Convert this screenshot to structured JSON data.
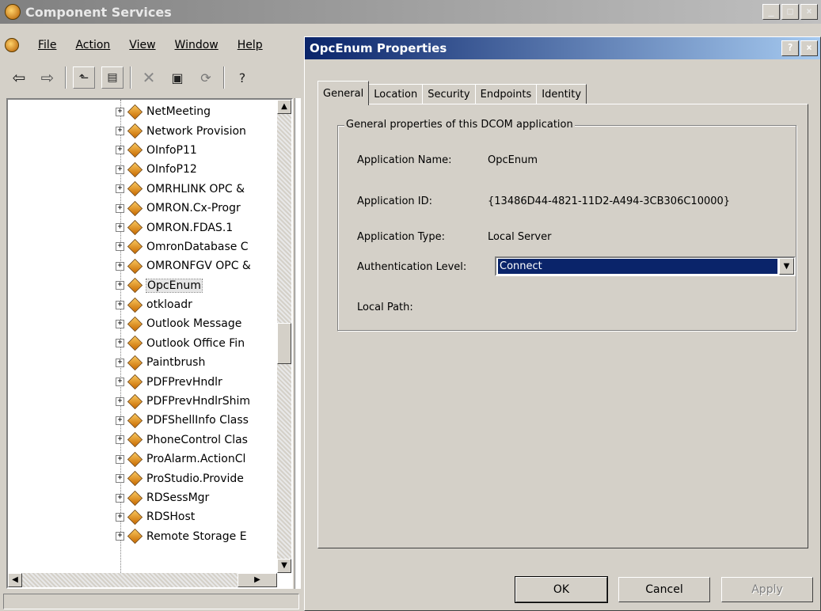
{
  "window": {
    "title": "Component Services",
    "icon": "component-services-icon",
    "caption_buttons": [
      "_",
      "□",
      "×"
    ]
  },
  "menu": {
    "items": [
      {
        "label": "File",
        "accel": "F"
      },
      {
        "label": "Action",
        "accel": "A"
      },
      {
        "label": "View",
        "accel": "V"
      },
      {
        "label": "Window",
        "accel": "W"
      },
      {
        "label": "Help",
        "accel": "H"
      }
    ]
  },
  "toolbar": {
    "icons": [
      "back-arrow-icon",
      "forward-arrow-icon",
      "up-folder-icon",
      "show-hide-tree-icon",
      "delete-icon",
      "properties-icon",
      "refresh-icon",
      "help-icon"
    ]
  },
  "tree": {
    "items": [
      {
        "label": "NetMeeting",
        "selected": false
      },
      {
        "label": "Network Provision",
        "selected": false
      },
      {
        "label": "OInfoP11",
        "selected": false
      },
      {
        "label": "OInfoP12",
        "selected": false
      },
      {
        "label": "OMRHLINK OPC &",
        "selected": false
      },
      {
        "label": "OMRON.Cx-Progr",
        "selected": false
      },
      {
        "label": "OMRON.FDAS.1",
        "selected": false
      },
      {
        "label": "OmronDatabase C",
        "selected": false
      },
      {
        "label": "OMRONFGV OPC &",
        "selected": false
      },
      {
        "label": "OpcEnum",
        "selected": true
      },
      {
        "label": "otkloadr",
        "selected": false
      },
      {
        "label": "Outlook Message",
        "selected": false
      },
      {
        "label": "Outlook Office Fin",
        "selected": false
      },
      {
        "label": "Paintbrush",
        "selected": false
      },
      {
        "label": "PDFPrevHndlr",
        "selected": false
      },
      {
        "label": "PDFPrevHndlrShim",
        "selected": false
      },
      {
        "label": "PDFShellInfo Class",
        "selected": false
      },
      {
        "label": "PhoneControl Clas",
        "selected": false
      },
      {
        "label": "ProAlarm.ActionCl",
        "selected": false
      },
      {
        "label": "ProStudio.Provide",
        "selected": false
      },
      {
        "label": "RDSessMgr",
        "selected": false
      },
      {
        "label": "RDSHost",
        "selected": false
      },
      {
        "label": "Remote Storage E",
        "selected": false
      }
    ],
    "expander_glyph": "+",
    "scroll_up_glyph": "▲",
    "scroll_down_glyph": "▼",
    "scroll_left_glyph": "◀",
    "scroll_right_glyph": "▶"
  },
  "dialog": {
    "title": "OpcEnum Properties",
    "help_button": "?",
    "close_button": "×",
    "tabs": [
      "General",
      "Location",
      "Security",
      "Endpoints",
      "Identity"
    ],
    "active_tab": "General",
    "group_title": "General properties of this DCOM application",
    "application_name_label": "Application Name:",
    "application_name_value": "OpcEnum",
    "application_id_label": "Application ID:",
    "application_id_value": "{13486D44-4821-11D2-A494-3CB306C10000}",
    "application_type_label": "Application Type:",
    "application_type_value": "Local Server",
    "authentication_level_label": "Authentication Level:",
    "authentication_level_value": "Connect",
    "combo_arrow": "▼",
    "local_path_label": "Local Path:",
    "local_path_value": "",
    "ok_label": "OK",
    "cancel_label": "Cancel",
    "apply_label": "Apply"
  }
}
